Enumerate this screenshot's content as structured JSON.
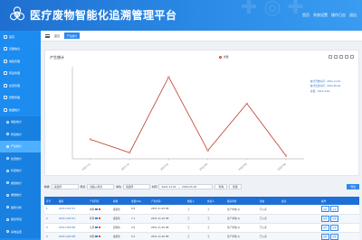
{
  "header": {
    "title": "医疗废物智能化追溯管理平台",
    "links": [
      "首页",
      "系统设置",
      "操作日志",
      "退出"
    ]
  },
  "sidebar": {
    "items": [
      {
        "label": "首页",
        "sub": false,
        "active": false
      },
      {
        "label": "基础信息",
        "sub": false,
        "active": false
      },
      {
        "label": "收集管理",
        "sub": false,
        "active": false
      },
      {
        "label": "转运管理",
        "sub": false,
        "active": false
      },
      {
        "label": "处置管理",
        "sub": false,
        "active": false
      },
      {
        "label": "预警管理",
        "sub": false,
        "active": false
      },
      {
        "label": "数据统计",
        "sub": false,
        "active": false
      },
      {
        "label": "收集统计",
        "sub": true,
        "active": false
      },
      {
        "label": "转运统计",
        "sub": true,
        "active": false
      },
      {
        "label": "产生统计",
        "sub": true,
        "active": true
      },
      {
        "label": "处置统计",
        "sub": true,
        "active": false
      },
      {
        "label": "科室统计",
        "sub": true,
        "active": false
      },
      {
        "label": "类别统计",
        "sub": true,
        "active": false
      },
      {
        "label": "重量统计",
        "sub": true,
        "active": false
      },
      {
        "label": "趋势分析",
        "sub": true,
        "active": false
      },
      {
        "label": "报表导出",
        "sub": true,
        "active": false
      },
      {
        "label": "系统设置",
        "sub": true,
        "active": false
      }
    ]
  },
  "toolbar": {
    "crumb": "首页",
    "active_tab": "产生统计"
  },
  "panel": {
    "title": "产生统计",
    "legend": "重量"
  },
  "info": {
    "line1": "统计开始时间：2021-11-01",
    "line2": "统计结束时间：2022-05-02",
    "line3": "总量：1921.4 KG"
  },
  "chart_data": {
    "type": "line",
    "x": [
      "2021-11",
      "2021-12",
      "2022-01",
      "2022-02",
      "2022-03",
      "2022-04"
    ],
    "series": [
      {
        "name": "重量",
        "values": [
          95,
          30,
          400,
          40,
          270,
          15
        ]
      }
    ],
    "ylim": [
      0,
      450
    ],
    "color": "#c0392b",
    "grid": false
  },
  "filters": {
    "type_label": "种类",
    "type_value": "请选择",
    "dept_label": "科室",
    "dept_value": "请输入科室",
    "unit_label": "单位",
    "unit_value": "请选择",
    "time_label": "时间",
    "start": "2021-11-01",
    "end": "2022-05-02",
    "search": "查询",
    "reset": "重置",
    "export": "导出"
  },
  "table": {
    "headers": [
      "序号",
      "编码",
      "产生科室",
      "种类",
      "重量(KG)",
      "产生时间",
      "收集人",
      "交接人",
      "储存单位",
      "状态",
      "备注",
      "操作"
    ],
    "rows": [
      [
        "1",
        "20211102713",
        "内科",
        "感染性",
        "6.8",
        "2021-11-02 08:",
        "王",
        "王",
        "生产单位(1)",
        "已入库",
        "",
        ""
      ],
      [
        "2",
        "20211102712",
        "外科",
        "感染性",
        "7.1",
        "2021-11-02 08:",
        "王",
        "王",
        "生产单位(1)",
        "已入库",
        "",
        ""
      ],
      [
        "3",
        "20211102709",
        "儿科",
        "损伤性",
        "3.6",
        "2021-11-02 08:",
        "王",
        "王",
        "生产单位(1)",
        "已入库",
        "",
        ""
      ],
      [
        "4",
        "20211102708",
        "内科",
        "感染性",
        "5.2",
        "2021-11-02 08:",
        "王",
        "王",
        "生产单位(1)",
        "已入库",
        "",
        ""
      ]
    ],
    "op_view": "查看",
    "op_track": "追溯"
  }
}
